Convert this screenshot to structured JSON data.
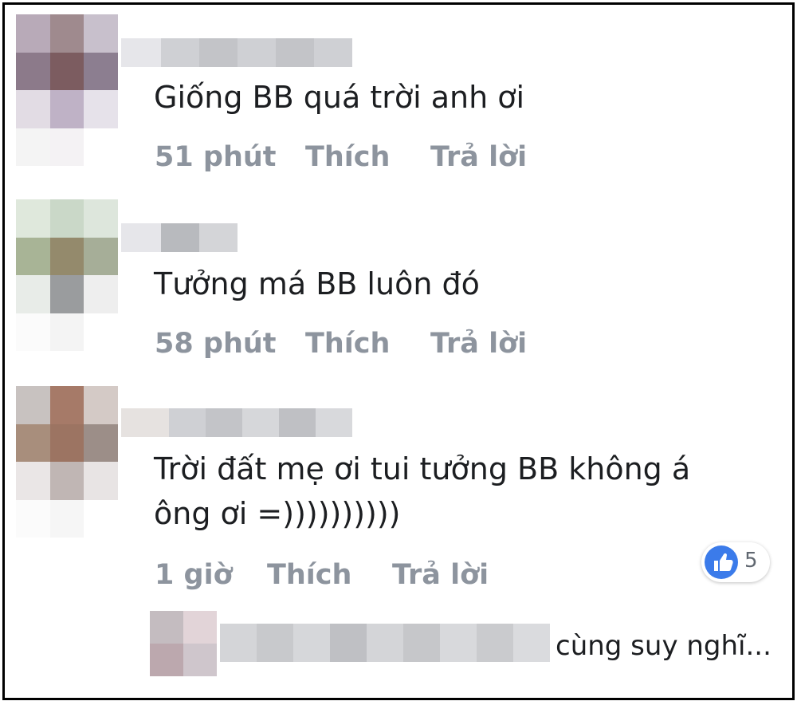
{
  "comments": [
    {
      "text": "Giống BB quá trời anh ơi",
      "time": "51 phút",
      "like": "Thích",
      "reply": "Trả lời"
    },
    {
      "text": "Tưởng má BB luôn đó",
      "time": "58 phút",
      "like": "Thích",
      "reply": "Trả lời"
    },
    {
      "text_line1": "Trời đất mẹ ơi tui tưởng BB không á",
      "text_line2": "ông ơi =))))))))))",
      "time": "1 giờ",
      "like": "Thích",
      "reply": "Trả lời",
      "reaction_count": "5",
      "reaction_icon": "thumbs-up-icon"
    }
  ],
  "reply_preview": {
    "text": "cùng suy nghĩ..."
  },
  "colors": {
    "bubble": "#f0f1f4",
    "meta": "#8d949e",
    "like_blue": "#3b7bea"
  }
}
